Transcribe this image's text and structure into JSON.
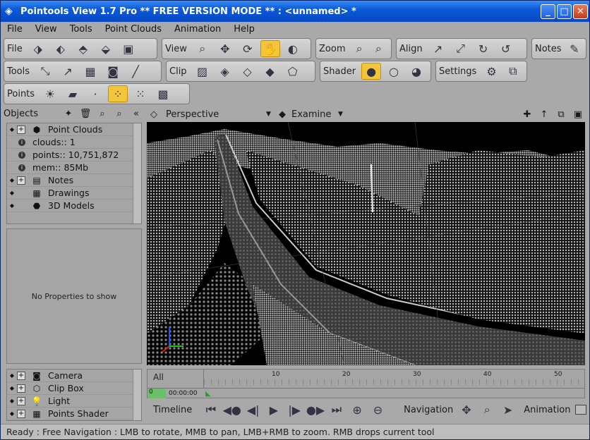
{
  "window": {
    "title": "Pointools View 1.7 Pro ** FREE VERSION MODE **  :  <unnamed> *",
    "minimize": "_",
    "maximize": "□",
    "close": "✕"
  },
  "menu": [
    "File",
    "View",
    "Tools",
    "Point Clouds",
    "Animation",
    "Help"
  ],
  "toolbars": {
    "file": "File",
    "view": "View",
    "zoom": "Zoom",
    "align": "Align",
    "notes": "Notes",
    "tools": "Tools",
    "clip": "Clip",
    "shader": "Shader",
    "settings": "Settings",
    "points": "Points"
  },
  "objects": {
    "label": "Objects",
    "tree": [
      {
        "label": "Point Clouds",
        "icon": "point-cloud-icon"
      },
      {
        "label": "clouds:: 1"
      },
      {
        "label": "points:: 10,751,872"
      },
      {
        "label": "mem:: 85Mb"
      },
      {
        "label": "Notes",
        "icon": "notes-icon"
      },
      {
        "label": "Drawings",
        "icon": "drawings-icon"
      },
      {
        "label": "3D Models",
        "icon": "models-icon"
      }
    ],
    "properties_empty": "No Properties to show",
    "lower_tree": [
      {
        "label": "Camera",
        "icon": "camera-icon"
      },
      {
        "label": "Clip Box",
        "icon": "clip-box-icon"
      },
      {
        "label": "Light",
        "icon": "light-icon"
      },
      {
        "label": "Points Shader",
        "icon": "points-shader-icon"
      }
    ]
  },
  "viewport": {
    "projection": "Perspective",
    "mode": "Examine"
  },
  "timeline": {
    "track_label": "All",
    "time": "00:00:00",
    "marker": "0",
    "ticks": [
      "10",
      "20",
      "30",
      "40",
      "50"
    ]
  },
  "bottom": {
    "timeline_label": "Timeline",
    "navigation_label": "Navigation",
    "animation_label": "Animation"
  },
  "status": "Ready : Free Navigation : LMB to rotate, MMB to pan, LMB+RMB to zoom. RMB drops current tool",
  "colors": {
    "title_blue": "#0a5ad8",
    "active_tool": "#f2c53a",
    "panel": "#a9a9a9"
  }
}
